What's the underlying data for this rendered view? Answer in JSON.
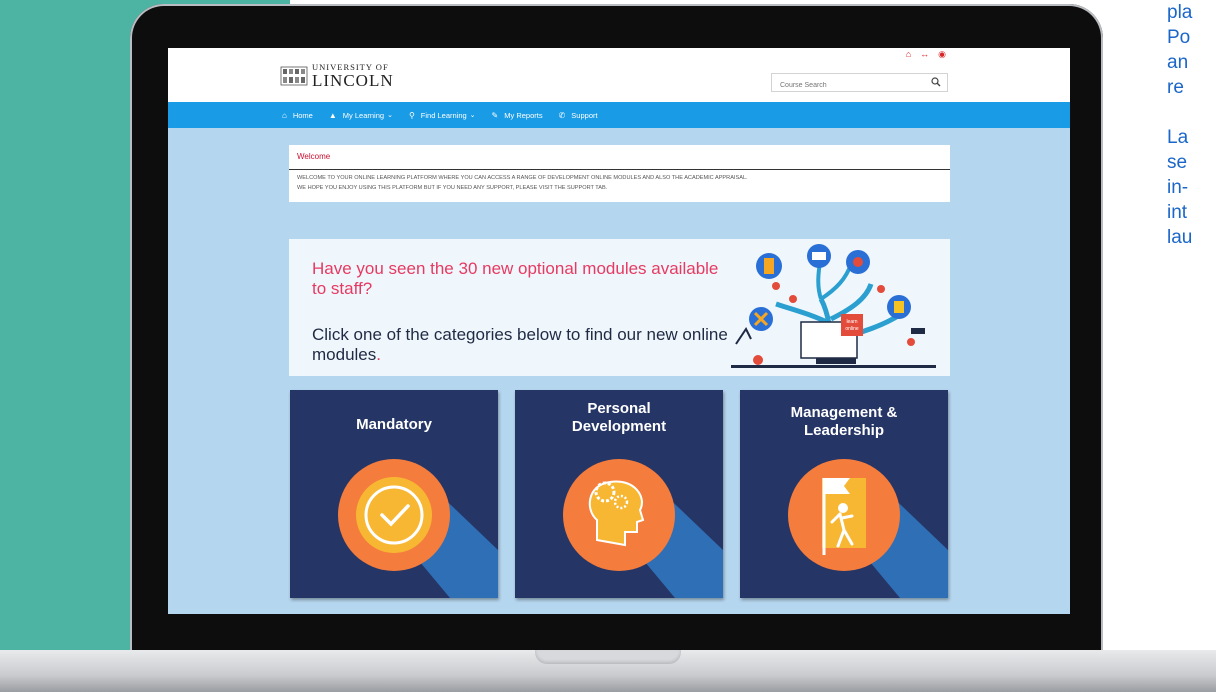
{
  "side_text": "pla\nPo\nan\nre\n\nLa\nse\nin-\nint\nlau",
  "header": {
    "logo_small": "UNIVERSITY OF",
    "logo_large": "LINCOLN",
    "search_placeholder": "Course Search"
  },
  "nav": {
    "items": [
      {
        "label": "Home",
        "icon": "home-icon"
      },
      {
        "label": "My Learning",
        "icon": "graduation-cap-icon",
        "dropdown": true
      },
      {
        "label": "Find Learning",
        "icon": "search-icon",
        "dropdown": true
      },
      {
        "label": "My Reports",
        "icon": "pencil-icon"
      },
      {
        "label": "Support",
        "icon": "phone-icon"
      }
    ]
  },
  "welcome": {
    "title": "Welcome",
    "line1": "WELCOME TO YOUR ONLINE LEARNING PLATFORM WHERE YOU CAN ACCESS A RANGE OF DEVELOPMENT ONLINE MODULES AND ALSO THE ACADEMIC APPRAISAL.",
    "line2": "WE HOPE YOU ENJOY USING THIS PLATFORM BUT IF YOU NEED ANY SUPPORT, PLEASE VISIT THE SUPPORT TAB."
  },
  "banner": {
    "headline": "Have you seen the 30 new optional modules available to staff?",
    "subline": "Click one of the categories below to find our new online modules",
    "subline_dot": ".",
    "illustration_label_1": "learn",
    "illustration_label_2": "online"
  },
  "cards": [
    {
      "title": "Mandatory",
      "icon": "checkmark-icon"
    },
    {
      "title": "Personal Development",
      "title_l1": "Personal",
      "title_l2": "Development",
      "icon": "head-gear-icon"
    },
    {
      "title": "Management & Leadership",
      "title_l1": "Management &",
      "title_l2": "Leadership",
      "icon": "person-flag-icon"
    }
  ],
  "colors": {
    "teal": "#4db3a2",
    "nav_blue": "#1a9be6",
    "screen_bg": "#b5d6ef",
    "card_navy": "#253566",
    "circle_orange": "#f47c3c",
    "accent_pink": "#e63a62"
  }
}
